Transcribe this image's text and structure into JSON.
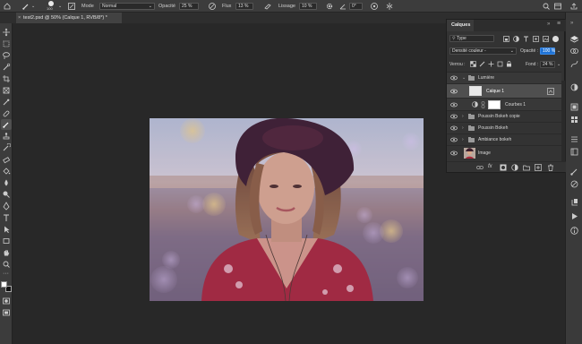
{
  "options_bar": {
    "brush_size": "100",
    "mode_label": "Mode",
    "mode_value": "Normal",
    "opacity_label": "Opacité",
    "opacity_value": "25 %",
    "flow_label": "Flux",
    "flow_value": "13 %",
    "smoothing_label": "Lissage",
    "smoothing_value": "10 %",
    "angle_value": "0°"
  },
  "document_tab": {
    "title": "test2.psd @ 50% (Calque 1, RVB/8*) *",
    "close_glyph": "×"
  },
  "layers_panel": {
    "tab_label": "Calques",
    "filter_value": "Type",
    "blend_mode_value": "Densité couleur -",
    "opacity_label": "Opacité :",
    "opacity_value": "100 %",
    "lock_label": "Verrou :",
    "fill_label": "Fond :",
    "fill_value": "24 %",
    "layers": [
      {
        "name": "Lumière",
        "type": "folder",
        "open": true
      },
      {
        "name": "Calque 1",
        "type": "layer",
        "selected": true
      },
      {
        "name": "Courbes 1",
        "type": "adjustment"
      },
      {
        "name": "Poussin Bokeh copie",
        "type": "folder"
      },
      {
        "name": "Poussin Bokeh",
        "type": "folder"
      },
      {
        "name": "Ambiance bokeh",
        "type": "folder"
      },
      {
        "name": "Image",
        "type": "image"
      }
    ]
  },
  "colors": {
    "accent": "#1f73d6",
    "panel_bg": "#333333",
    "app_bg": "#282828"
  }
}
